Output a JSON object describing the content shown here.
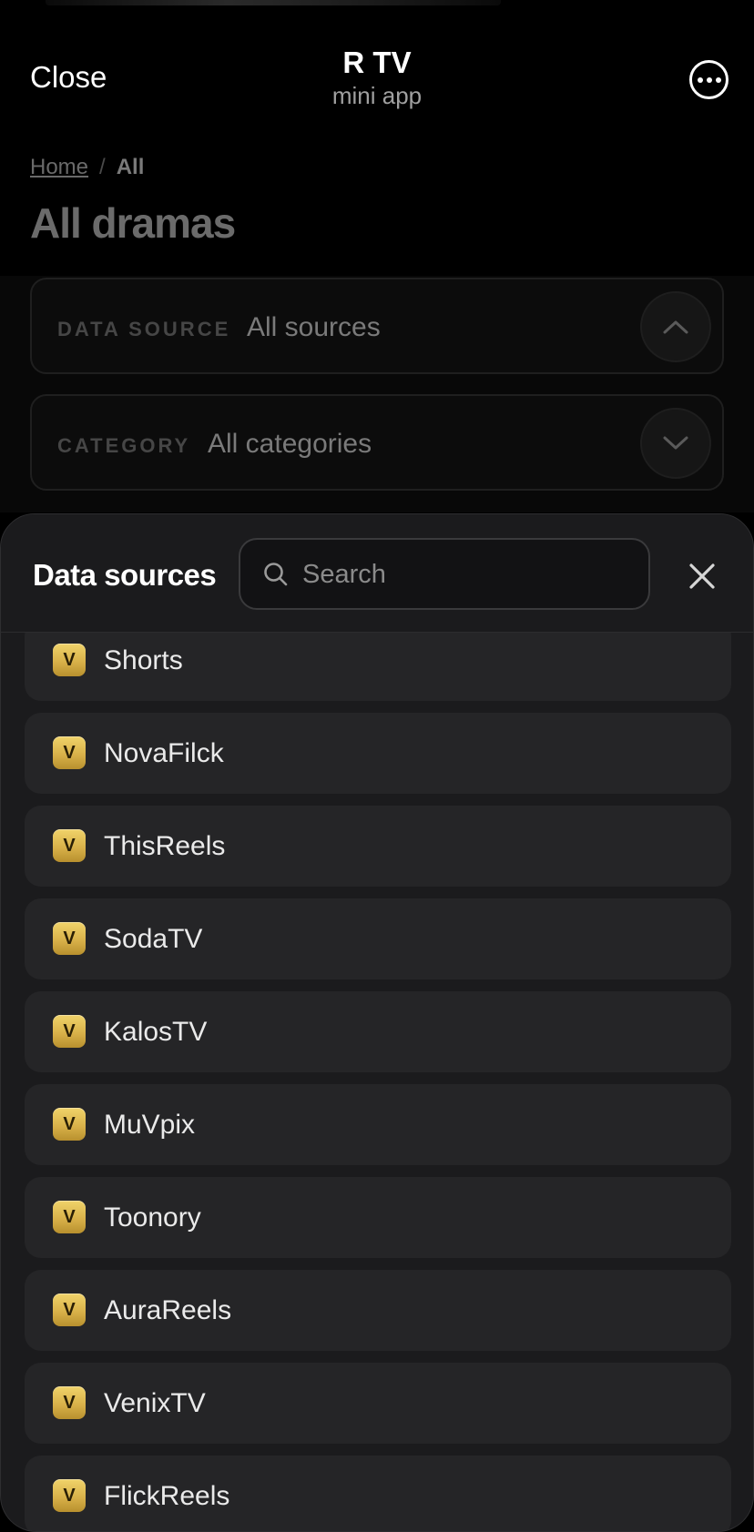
{
  "header": {
    "close_label": "Close",
    "app_title": "R TV",
    "app_subtitle": "mini app",
    "more_icon": "ellipsis-circle-icon"
  },
  "breadcrumb": {
    "home": "Home",
    "separator": "/",
    "current": "All"
  },
  "page": {
    "title": "All dramas"
  },
  "filters": {
    "source": {
      "label": "DATA SOURCE",
      "value": "All sources",
      "expanded": true
    },
    "category": {
      "label": "CATEGORY",
      "value": "All categories",
      "expanded": false
    }
  },
  "sheet": {
    "title": "Data sources",
    "search_placeholder": "Search",
    "close_icon": "close-icon",
    "badge_letter": "V",
    "badge_color": "#e0bb4f",
    "items": [
      {
        "label": "Shorts"
      },
      {
        "label": "NovaFilck"
      },
      {
        "label": "ThisReels"
      },
      {
        "label": "SodaTV"
      },
      {
        "label": "KalosTV"
      },
      {
        "label": "MuVpix"
      },
      {
        "label": "Toonory"
      },
      {
        "label": "AuraReels"
      },
      {
        "label": "VenixTV"
      },
      {
        "label": "FlickReels"
      }
    ]
  }
}
